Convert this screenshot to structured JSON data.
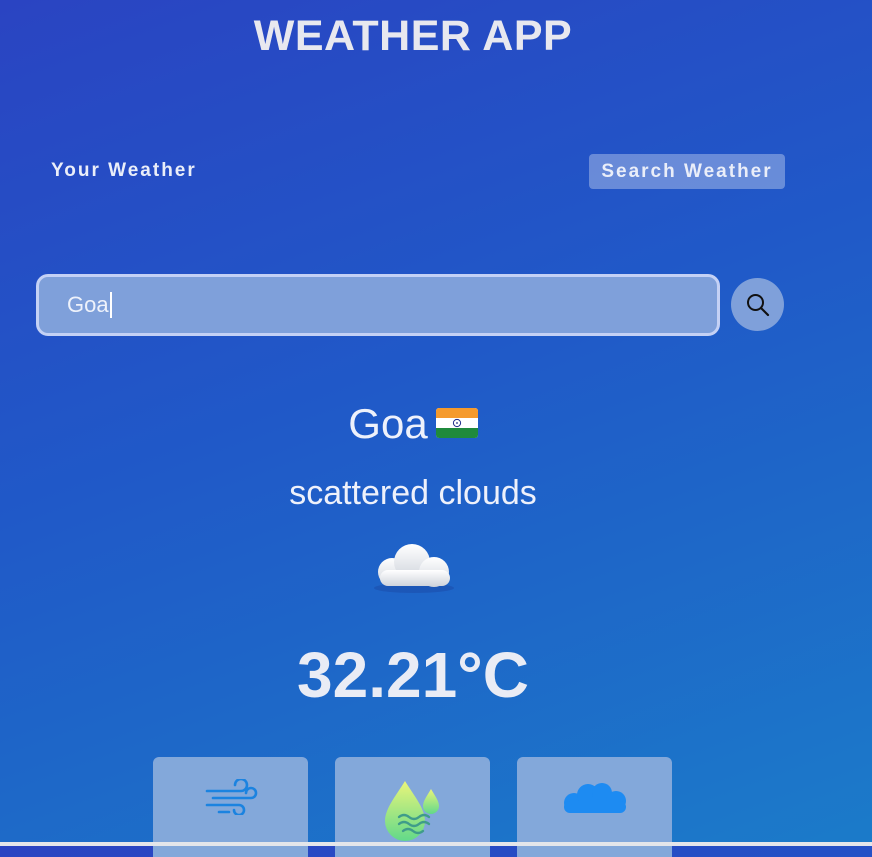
{
  "header": {
    "title": "WEATHER APP"
  },
  "tabs": [
    {
      "label": "Your Weather",
      "active": false
    },
    {
      "label": "Search Weather",
      "active": true
    }
  ],
  "search": {
    "value": "Goa",
    "icon": "search-icon"
  },
  "weather": {
    "city": "Goa",
    "country_flag": "india-flag-icon",
    "description": "scattered clouds",
    "condition_icon": "cloud-icon",
    "temperature": "32.21°C"
  },
  "detail_cards": [
    {
      "icon": "wind-icon"
    },
    {
      "icon": "humidity-icon"
    },
    {
      "icon": "clouds-icon"
    }
  ],
  "colors": {
    "background_top": "#2a44c2",
    "background_bottom": "#1b7bc9",
    "input_fill": "#7fa0da",
    "card_fill": "#83a8da",
    "wind_icon": "#1b83e0",
    "humidity_icon_start": "#e9f57a",
    "humidity_icon_end": "#62d98a",
    "clouds_icon": "#1d8bf2"
  }
}
